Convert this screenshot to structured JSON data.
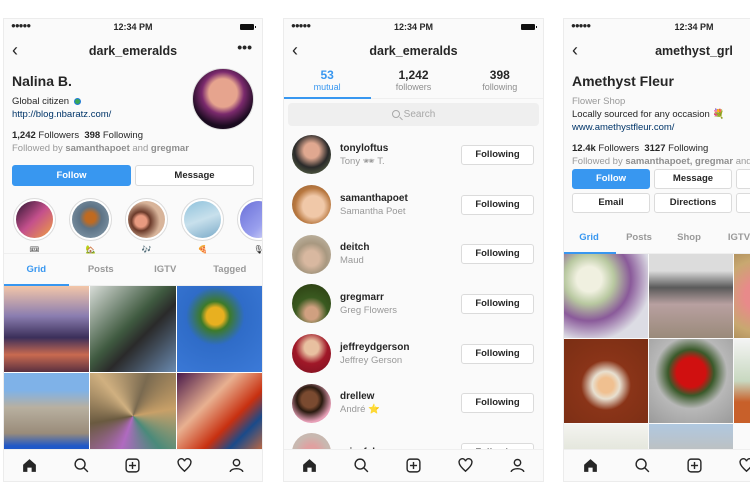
{
  "status_bar": {
    "signal": "●●●●●",
    "time": "12:34 PM"
  },
  "screen1": {
    "nav_title": "dark_emeralds",
    "more_label": "•••",
    "profile_name": "Nalina B.",
    "bio": "Global citizen",
    "link": "http://blog.nbaratz.com/",
    "followers_count": "1,242",
    "followers_label": "Followers",
    "following_count": "398",
    "following_label": "Following",
    "followed_by_prefix": "Followed by",
    "followed_by_user1": "samanthapoet",
    "followed_by_and": "and",
    "followed_by_user2": "gregmar",
    "follow_button": "Follow",
    "message_button": "Message",
    "highlights": [
      {
        "emoji": "🎟"
      },
      {
        "emoji": "🏡"
      },
      {
        "emoji": "🎶"
      },
      {
        "emoji": "🍕"
      },
      {
        "emoji": "🎙"
      }
    ],
    "tabs": [
      "Grid",
      "Posts",
      "IGTV",
      "Tagged"
    ],
    "active_tab": "Grid"
  },
  "screen2": {
    "nav_title": "dark_emeralds",
    "stats": [
      {
        "num": "53",
        "label": "mutual"
      },
      {
        "num": "1,242",
        "label": "followers"
      },
      {
        "num": "398",
        "label": "following"
      }
    ],
    "search_placeholder": "Search",
    "users": [
      {
        "username": "tonyloftus",
        "fullname": "Tony 🕶 T.",
        "button": "Following"
      },
      {
        "username": "samanthapoet",
        "fullname": "Samantha Poet",
        "button": "Following"
      },
      {
        "username": "deitch",
        "fullname": "Maud",
        "button": "Following"
      },
      {
        "username": "gregmarr",
        "fullname": "Greg Flowers",
        "button": "Following"
      },
      {
        "username": "jeffreydgerson",
        "fullname": "Jeffrey Gerson",
        "button": "Following"
      },
      {
        "username": "drellew",
        "fullname": "André ⭐",
        "button": "Following"
      },
      {
        "username": "ericafahr",
        "fullname": "",
        "button": "Following"
      }
    ]
  },
  "screen3": {
    "nav_title": "amethyst_grl",
    "profile_name": "Amethyst Fleur",
    "category": "Flower Shop",
    "bio": "Locally sourced for any occasion 💐",
    "link": "www.amethystfleur.com/",
    "followers_count": "12.4k",
    "followers_label": "Followers",
    "following_count": "3127",
    "following_label": "Following",
    "followed_by_prefix": "Followed by",
    "followed_by_users": "samanthapoet, gregmar",
    "followed_by_suffix": "and",
    "buttons": [
      "Follow",
      "Message",
      "",
      "Email",
      "Directions",
      ""
    ],
    "tabs": [
      "Grid",
      "Posts",
      "Shop",
      "IGTV"
    ],
    "active_tab": "Grid"
  },
  "bottom_nav": [
    "home",
    "search",
    "new-post",
    "activity",
    "profile"
  ],
  "colors": {
    "accent": "#3897f0",
    "link": "#003569",
    "muted": "#999999"
  }
}
